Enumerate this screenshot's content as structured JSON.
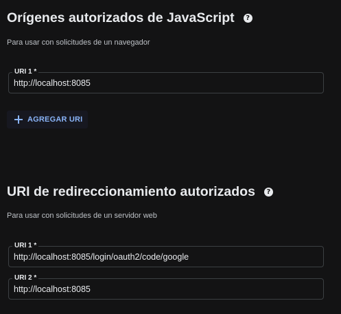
{
  "js_origins": {
    "title": "Orígenes autorizados de JavaScript",
    "subtitle": "Para usar con solicitudes de un navegador",
    "uris": [
      {
        "label": "URI 1 *",
        "value": "http://localhost:8085"
      }
    ],
    "add_button": {
      "label": "AGREGAR URI",
      "icon": "plus-icon"
    }
  },
  "redirect_uris": {
    "title": "URI de redireccionamiento autorizados",
    "subtitle": "Para usar con solicitudes de un servidor web",
    "uris": [
      {
        "label": "URI 1 *",
        "value": "http://localhost:8085/login/oauth2/code/google"
      },
      {
        "label": "URI 2 *",
        "value": "http://localhost:8085"
      }
    ]
  },
  "help_icon_glyph": "?",
  "colors": {
    "background": "#131314",
    "accent": "#8ab4f8",
    "border": "#3c4043",
    "text": "#e8eaed"
  }
}
